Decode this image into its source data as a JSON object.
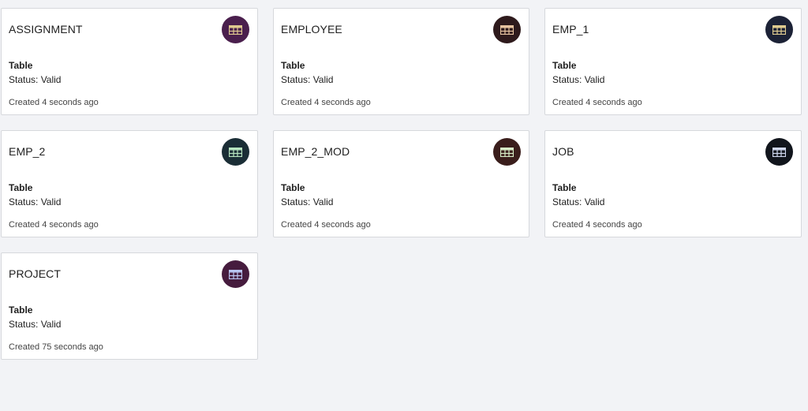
{
  "cards": [
    {
      "title": "ASSIGNMENT",
      "type": "Table",
      "status": "Status: Valid",
      "created": "Created 4 seconds ago",
      "icon": "table-icon",
      "badge_bg": "#4a1f4d",
      "icon_color": "#e0c98f"
    },
    {
      "title": "EMPLOYEE",
      "type": "Table",
      "status": "Status: Valid",
      "created": "Created 4 seconds ago",
      "icon": "table-icon",
      "badge_bg": "#2e1a1c",
      "icon_color": "#e8c4a0"
    },
    {
      "title": "EMP_1",
      "type": "Table",
      "status": "Status: Valid",
      "created": "Created 4 seconds ago",
      "icon": "table-icon",
      "badge_bg": "#1c2236",
      "icon_color": "#e0cc90"
    },
    {
      "title": "EMP_2",
      "type": "Table",
      "status": "Status: Valid",
      "created": "Created 4 seconds ago",
      "icon": "table-icon",
      "badge_bg": "#1b2e36",
      "icon_color": "#b8e6c0"
    },
    {
      "title": "EMP_2_MOD",
      "type": "Table",
      "status": "Status: Valid",
      "created": "Created 4 seconds ago",
      "icon": "table-icon",
      "badge_bg": "#3a1e1c",
      "icon_color": "#d8efc8"
    },
    {
      "title": "JOB",
      "type": "Table",
      "status": "Status: Valid",
      "created": "Created 4 seconds ago",
      "icon": "table-icon",
      "badge_bg": "#11151c",
      "icon_color": "#d0d8f0"
    },
    {
      "title": "PROJECT",
      "type": "Table",
      "status": "Status: Valid",
      "created": "Created 75 seconds ago",
      "icon": "table-icon",
      "badge_bg": "#461c3e",
      "icon_color": "#b8c4f0"
    }
  ]
}
